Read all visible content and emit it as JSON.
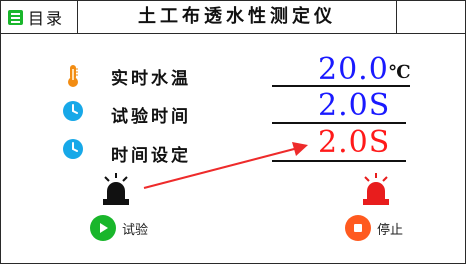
{
  "header": {
    "menu_label": "目录",
    "title": "土工布透水性测定仪"
  },
  "rows": [
    {
      "label": "实时水温",
      "value": "20.0",
      "unit": "℃"
    },
    {
      "label": "试验时间",
      "value": "2.0S"
    },
    {
      "label": "时间设定",
      "value": "2.0S"
    }
  ],
  "actions": {
    "test_label": "试验",
    "stop_label": "停止"
  },
  "colors": {
    "accent_green": "#19b62b",
    "value_blue": "#1a1aff",
    "value_red": "#ff1a1a",
    "icon_cyan": "#17a8e8",
    "thermometer_orange": "#f28c12",
    "stop_orange": "#ff5a1f"
  }
}
